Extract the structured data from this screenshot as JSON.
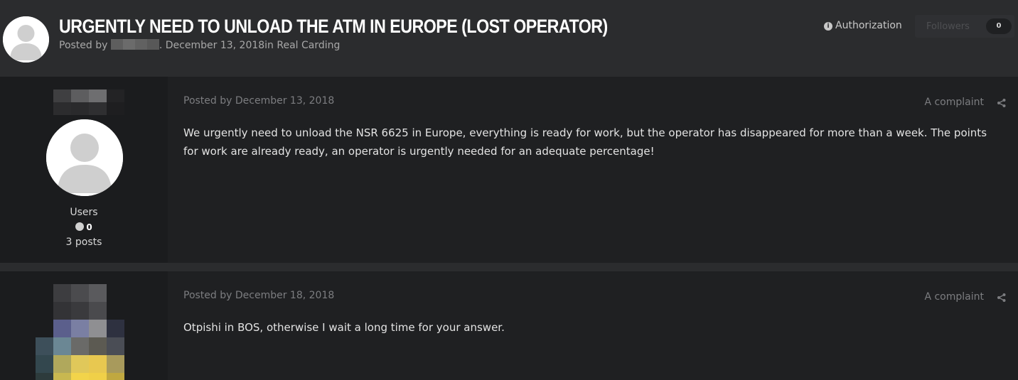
{
  "header": {
    "title": "URGENTLY NEED TO UNLOAD THE ATM IN EUROPE (LOST OPERATOR)",
    "posted_by_prefix": "Posted by",
    "date_and_forum": ". December 13, 2018in Real Carding",
    "authorization_label": "Authorization",
    "followers_label": "Followers",
    "followers_count": "0"
  },
  "posts": [
    {
      "date": "Posted by December 13, 2018",
      "complaint_label": "A complaint",
      "text": "We urgently need to unload the NSR 6625 in Europe, everything is ready for work, but the operator has disappeared for more than a week. The points for work are already ready, an operator is urgently needed for an adequate percentage!",
      "author_group": "Users",
      "reputation": "0",
      "post_count": "3 posts"
    },
    {
      "date": "Posted by December 18, 2018",
      "complaint_label": "A complaint",
      "text": "Otpishi in BOS, otherwise I wait a long time for your answer."
    }
  ],
  "colors": {
    "background": "#2b2c2e",
    "post_body": "#1f2022",
    "author_column": "#1b1c1e",
    "muted_text": "#7c7d80"
  },
  "icons": {
    "authorization": "info-circle-icon",
    "complaint_share": "share-icon",
    "reputation": "reputation-dot-icon"
  }
}
